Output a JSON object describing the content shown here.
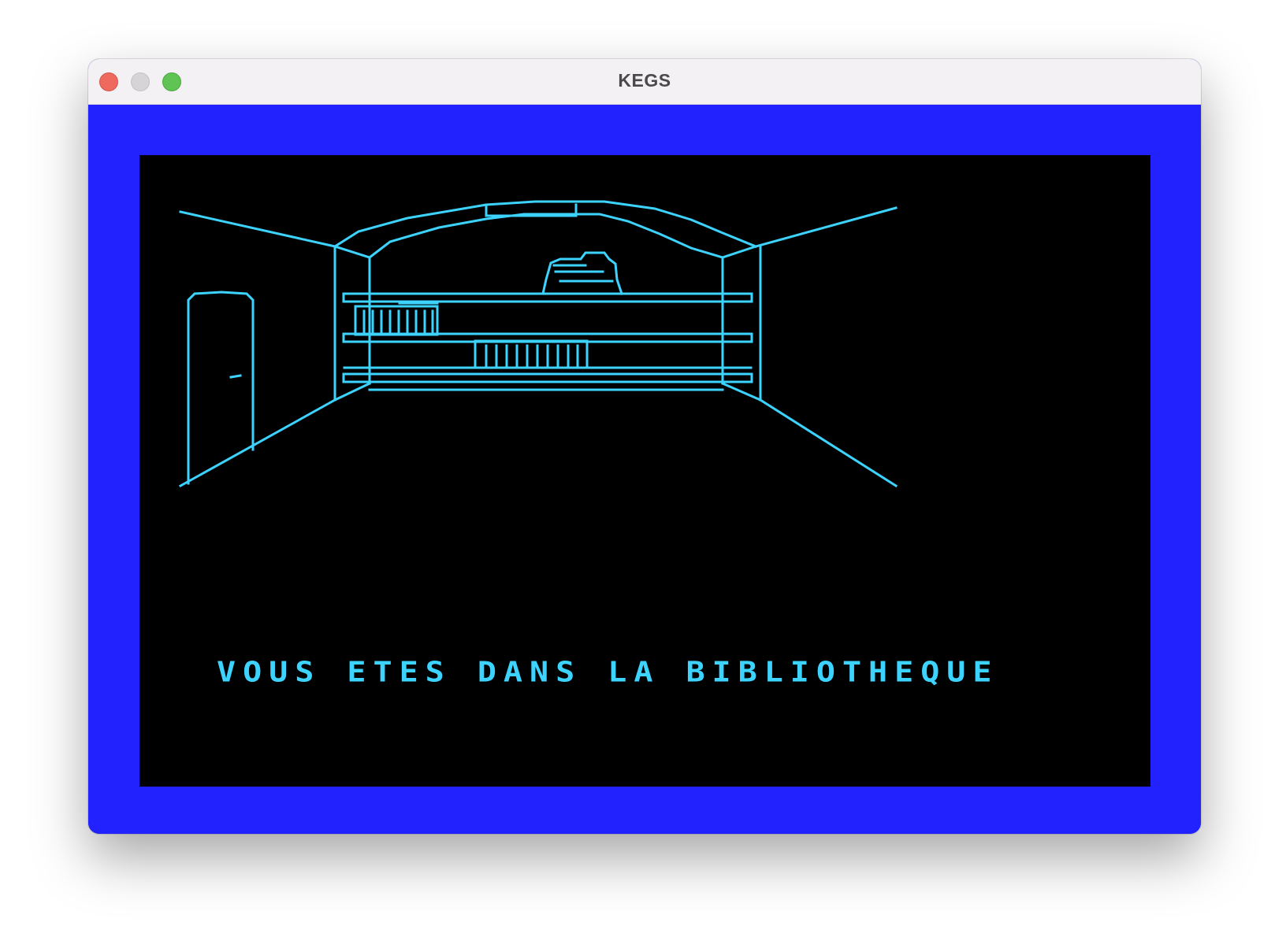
{
  "window": {
    "title": "KEGS"
  },
  "game": {
    "message": "VOUS ETES DANS LA BIBLIOTHEQUE",
    "colors": {
      "border": "#2222ff",
      "screen": "#000000",
      "foreground": "#3cd3ff"
    }
  },
  "icons": {
    "close": "close-button",
    "minimize": "minimize-button",
    "maximize": "maximize-button"
  }
}
